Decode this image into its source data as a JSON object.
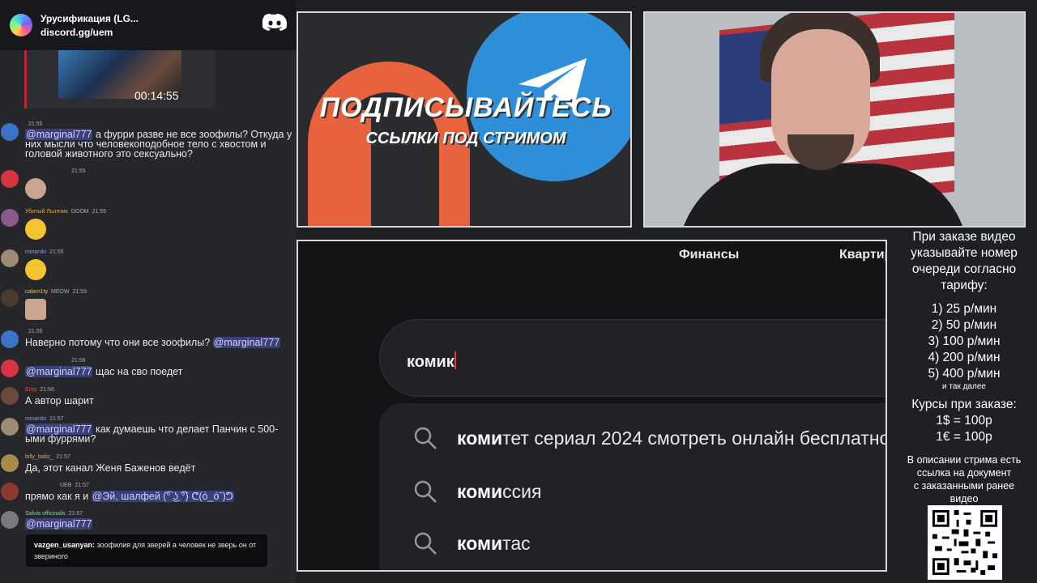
{
  "discord": {
    "server_name": "Урусификация (LG...",
    "invite": "discord.gg/uem"
  },
  "clip": {
    "time": "00:14:55"
  },
  "chat": [
    {
      "user": "",
      "time": "21:55",
      "mention": "@marginal777",
      "text": " а фурри разве не все зоофилы? Откуда у них мысли что человекоподобное тело с хвостом и головой животного это сексуально?"
    },
    {
      "user": "",
      "time": "21:55",
      "emoji": "woman-emoji"
    },
    {
      "user": "Убитый Льопчик",
      "badge": "DOOM",
      "time": "21:55",
      "emoji": "laughing-emoji"
    },
    {
      "user": "minarski",
      "time": "21:55",
      "emoji": "laughing-emoji"
    },
    {
      "user": "calam1ty",
      "badge": "MEOW",
      "time": "21:55",
      "emoji": "facepalm-emoji"
    },
    {
      "user": "",
      "time": "21:55",
      "text": "Наверно потому что они все зоофилы? ",
      "mention": "@marginal777"
    },
    {
      "user": "",
      "time": "21:56",
      "mention": "@marginal777",
      "text": " щас на сво поедет"
    },
    {
      "user": "Erzo",
      "time": "21:56",
      "text": "А автор шарит"
    },
    {
      "user": "minarski",
      "time": "21:57",
      "mention": "@marginal777",
      "text": " как думаешь что делает Панчин с 500-ыми фуррями?"
    },
    {
      "user": "billy_balis_",
      "time": "21:57",
      "text": "Да, этот канал Женя Баженов ведёт"
    },
    {
      "user": "",
      "badge": "UEB",
      "time": "21:57",
      "text": "прямо как я и ",
      "mention": "@Эй, шалфей (͡° ͜ʖ ͡°) ᕦ(ò_óˇ)ᕤ"
    },
    {
      "user": "Salvia officinalis",
      "time": "21:57",
      "mention": "@marginal777"
    }
  ],
  "twitch": {
    "user": "vazgen_usanyan:",
    "text": " зоофилия для зверей а человек не зверь он от звериного"
  },
  "promo": {
    "title": "ПОДПИСЫВАЙТЕСЬ",
    "subtitle": "ССЫЛКИ ПОД СТРИМОМ"
  },
  "browser": {
    "nav_finance": "Финансы",
    "nav_apartments": "Квартиры",
    "query": "комик",
    "suggestions": [
      {
        "bold": "коми",
        "rest": "тет сериал 2024 смотреть онлайн бесплатно"
      },
      {
        "bold": "коми",
        "rest": "ссия"
      },
      {
        "bold": "коми",
        "rest": "тас"
      }
    ]
  },
  "info": {
    "header": [
      "При заказе видео",
      "указывайте номер",
      "очереди согласно",
      "тарифу:"
    ],
    "tariffs": [
      "1) 25 р/мин",
      "2) 50 р/мин",
      "3) 100 р/мин",
      "4) 200 р/мин",
      "5) 400 р/мин"
    ],
    "etc": "и так далее",
    "courses": [
      "Курсы при заказе:",
      "1$ = 100р",
      "1€ = 100р"
    ],
    "desc": [
      "В описании стрима есть",
      "ссылка на документ",
      "с заказанными ранее",
      "видео"
    ]
  }
}
